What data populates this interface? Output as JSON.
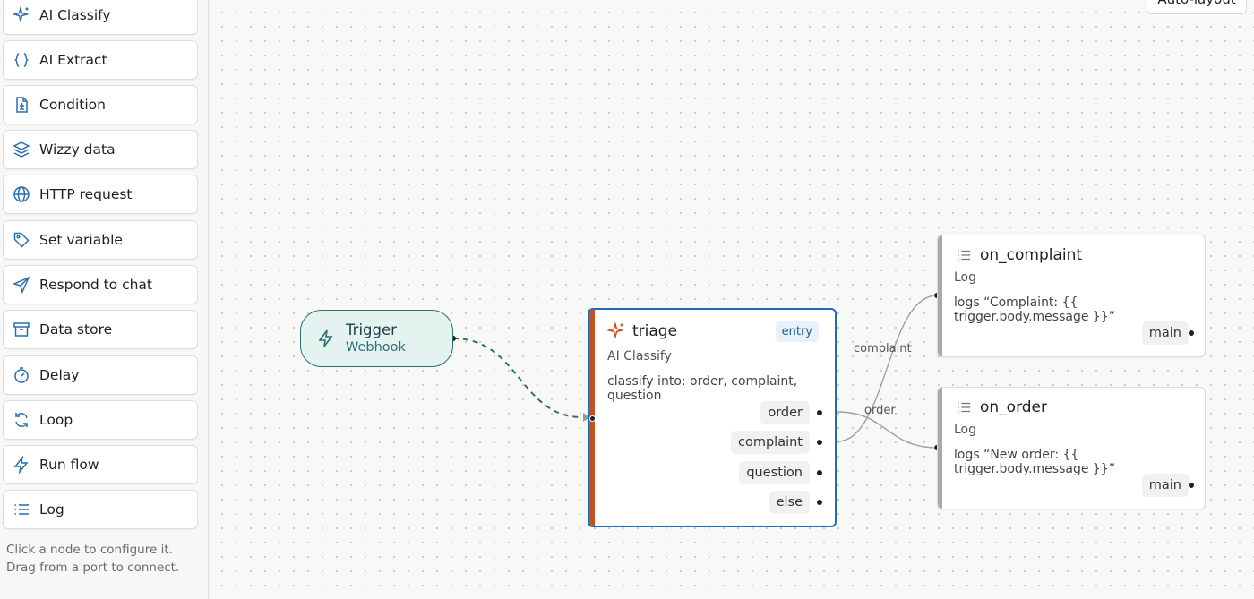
{
  "palette": {
    "items": [
      {
        "label": "AI Classify",
        "icon": "sparkle-icon"
      },
      {
        "label": "AI Extract",
        "icon": "braces-icon"
      },
      {
        "label": "Condition",
        "icon": "document-split-icon"
      },
      {
        "label": "Wizzy data",
        "icon": "layers-icon"
      },
      {
        "label": "HTTP request",
        "icon": "globe-icon"
      },
      {
        "label": "Set variable",
        "icon": "tag-icon"
      },
      {
        "label": "Respond to chat",
        "icon": "send-icon"
      },
      {
        "label": "Data store",
        "icon": "archive-icon"
      },
      {
        "label": "Delay",
        "icon": "stopwatch-icon"
      },
      {
        "label": "Loop",
        "icon": "loop-icon"
      },
      {
        "label": "Run flow",
        "icon": "bolt-icon"
      },
      {
        "label": "Log",
        "icon": "list-icon"
      }
    ],
    "hint_line1": "Click a node to configure it.",
    "hint_line2": "Drag from a port to connect."
  },
  "toolbar": {
    "autolayout_label": "Auto-layout"
  },
  "nodes": {
    "trigger": {
      "title": "Trigger",
      "subtitle": "Webhook"
    },
    "triage": {
      "title": "triage",
      "badge": "entry",
      "type": "AI Classify",
      "description": "classify into: order, complaint, question",
      "ports": [
        "order",
        "complaint",
        "question",
        "else"
      ]
    },
    "on_complaint": {
      "title": "on_complaint",
      "type": "Log",
      "description": "logs “Complaint: {{ trigger.body.message }}”",
      "port": "main"
    },
    "on_order": {
      "title": "on_order",
      "type": "Log",
      "description": "logs “New order: {{ trigger.body.message }}”",
      "port": "main"
    }
  },
  "edges": {
    "complaint_label": "complaint",
    "order_label": "order"
  },
  "colors": {
    "accent_blue": "#1f6db3",
    "trigger_teal": "#2c6f73",
    "ai_orange": "#c0531f",
    "log_gray": "#a9a9a9"
  }
}
